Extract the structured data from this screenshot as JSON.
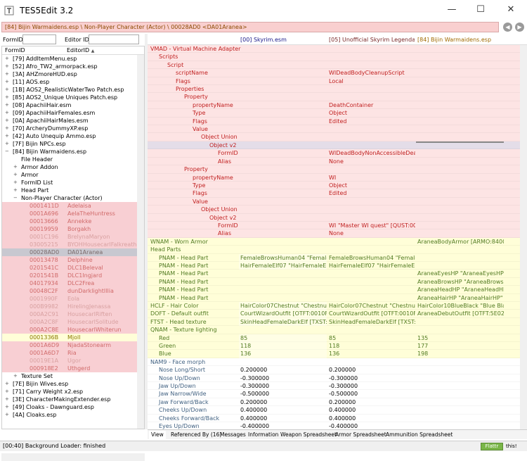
{
  "window": {
    "title": "TES5Edit 3.2",
    "min": "—",
    "max": "☐",
    "close": "✕"
  },
  "path": "[84] Bijin Warmaidens.esp \\ Non-Player Character (Actor) \\ 00028AD0 <DA01Aranea>",
  "nav": {
    "back": "◀",
    "fwd": "▶"
  },
  "filter": {
    "formid_label": "FormID",
    "editorid_label": "Editor ID",
    "formid_value": "",
    "editorid_value": ""
  },
  "tree": {
    "col1": "FormID",
    "col2": "EditorID",
    "sort": "▲",
    "rows": [
      {
        "ind": 0,
        "tg": "+",
        "a": "[79] AddItemMenu.esp",
        "b": "",
        "bg": "#fff",
        "fc": "#000"
      },
      {
        "ind": 0,
        "tg": "+",
        "a": "[52] Afro_TW2_armorpack.esp",
        "b": "",
        "bg": "#fff",
        "fc": "#000"
      },
      {
        "ind": 0,
        "tg": "+",
        "a": "[3A] AHZmoreHUD.esp",
        "b": "",
        "bg": "#fff",
        "fc": "#000"
      },
      {
        "ind": 0,
        "tg": "+",
        "a": "[11] AOS.esp",
        "b": "",
        "bg": "#fff",
        "fc": "#000"
      },
      {
        "ind": 0,
        "tg": "+",
        "a": "[1B] AOS2_RealisticWaterTwo Patch.esp",
        "b": "",
        "bg": "#fff",
        "fc": "#000"
      },
      {
        "ind": 0,
        "tg": "+",
        "a": "[85] AOS2_Unique Uniques Patch.esp",
        "b": "",
        "bg": "#fff",
        "fc": "#000"
      },
      {
        "ind": 0,
        "tg": "+",
        "a": "[08] ApachiiHair.esm",
        "b": "",
        "bg": "#fff",
        "fc": "#000"
      },
      {
        "ind": 0,
        "tg": "+",
        "a": "[09] ApachiiHairFemales.esm",
        "b": "",
        "bg": "#fff",
        "fc": "#000"
      },
      {
        "ind": 0,
        "tg": "+",
        "a": "[0A] ApachiiHairMales.esm",
        "b": "",
        "bg": "#fff",
        "fc": "#000"
      },
      {
        "ind": 0,
        "tg": "+",
        "a": "[70] ArcheryDummyXP.esp",
        "b": "",
        "bg": "#fff",
        "fc": "#000"
      },
      {
        "ind": 0,
        "tg": "+",
        "a": "[42] Auto Unequip Ammo.esp",
        "b": "",
        "bg": "#fff",
        "fc": "#000"
      },
      {
        "ind": 0,
        "tg": "+",
        "a": "[7F] Bijin NPCs.esp",
        "b": "",
        "bg": "#fff",
        "fc": "#000"
      },
      {
        "ind": 0,
        "tg": "−",
        "a": "[84] Bijin Warmaidens.esp",
        "b": "",
        "bg": "#fff",
        "fc": "#000"
      },
      {
        "ind": 1,
        "tg": "",
        "a": "File Header",
        "b": "",
        "bg": "#fff",
        "fc": "#000"
      },
      {
        "ind": 1,
        "tg": "+",
        "a": "Armor Addon",
        "b": "",
        "bg": "#fff",
        "fc": "#000"
      },
      {
        "ind": 1,
        "tg": "+",
        "a": "Armor",
        "b": "",
        "bg": "#fff",
        "fc": "#000"
      },
      {
        "ind": 1,
        "tg": "+",
        "a": "FormID List",
        "b": "",
        "bg": "#fff",
        "fc": "#000"
      },
      {
        "ind": 1,
        "tg": "+",
        "a": "Head Part",
        "b": "",
        "bg": "#fff",
        "fc": "#000"
      },
      {
        "ind": 1,
        "tg": "−",
        "a": "Non-Player Character (Actor)",
        "b": "",
        "bg": "#fff",
        "fc": "#000"
      },
      {
        "ind": 2,
        "tg": "",
        "a": "0001411D",
        "b": "Adelaisa",
        "bg": "#f8cfd3",
        "fc": "#d06a6a"
      },
      {
        "ind": 2,
        "tg": "",
        "a": "0001A696",
        "b": "AelaTheHuntress",
        "bg": "#f8cfd3",
        "fc": "#d06a6a"
      },
      {
        "ind": 2,
        "tg": "",
        "a": "00013666",
        "b": "Annekke",
        "bg": "#f8cfd3",
        "fc": "#d06a6a"
      },
      {
        "ind": 2,
        "tg": "",
        "a": "00019959",
        "b": "Borgakh",
        "bg": "#f8cfd3",
        "fc": "#d06a6a"
      },
      {
        "ind": 2,
        "tg": "",
        "a": "0001C196",
        "b": "BreIynaMaryon",
        "bg": "#f8cfd3",
        "fc": "#d8a0a0"
      },
      {
        "ind": 2,
        "tg": "",
        "a": "03005215",
        "b": "BYOHHousecarlFalkreath",
        "bg": "#f8cfd3",
        "fc": "#d8a0a0"
      },
      {
        "ind": 2,
        "tg": "",
        "a": "00028AD0",
        "b": "DA01Aranea",
        "bg": "#c8c8d0",
        "fc": "#7a6a6a"
      },
      {
        "ind": 2,
        "tg": "",
        "a": "00013478",
        "b": "Delphine",
        "bg": "#f8cfd3",
        "fc": "#d06a6a"
      },
      {
        "ind": 2,
        "tg": "",
        "a": "0201541C",
        "b": "DLC1Beleval",
        "bg": "#f8cfd3",
        "fc": "#d06a6a"
      },
      {
        "ind": 2,
        "tg": "",
        "a": "0201541B",
        "b": "DLC1Ingjard",
        "bg": "#f8cfd3",
        "fc": "#d06a6a"
      },
      {
        "ind": 2,
        "tg": "",
        "a": "04017934",
        "b": "DLC2Frea",
        "bg": "#f8cfd3",
        "fc": "#d06a6a"
      },
      {
        "ind": 2,
        "tg": "",
        "a": "00048C2F",
        "b": "dunDarklightIllia",
        "bg": "#f8cfd3",
        "fc": "#d06a6a"
      },
      {
        "ind": 2,
        "tg": "",
        "a": "0001990F",
        "b": "Eola",
        "bg": "#f8cfd3",
        "fc": "#d8a0a0"
      },
      {
        "ind": 2,
        "tg": "",
        "a": "000B9982",
        "b": "HirelingJenassa",
        "bg": "#f8cfd3",
        "fc": "#d8a0a0"
      },
      {
        "ind": 2,
        "tg": "",
        "a": "000A2C91",
        "b": "HousecarlRiften",
        "bg": "#f8cfd3",
        "fc": "#d8a0a0"
      },
      {
        "ind": 2,
        "tg": "",
        "a": "000A2C8F",
        "b": "HousecarlSolitude",
        "bg": "#f8cfd3",
        "fc": "#d8a0a0"
      },
      {
        "ind": 2,
        "tg": "",
        "a": "000A2C8E",
        "b": "HousecarlWhiterun",
        "bg": "#f8cfd3",
        "fc": "#d06a6a"
      },
      {
        "ind": 2,
        "tg": "",
        "a": "0001336B",
        "b": "Mjoll",
        "bg": "#fffed8",
        "fc": "#8a7a00"
      },
      {
        "ind": 2,
        "tg": "",
        "a": "0001A6D9",
        "b": "NjadaStonearm",
        "bg": "#f8cfd3",
        "fc": "#d06a6a"
      },
      {
        "ind": 2,
        "tg": "",
        "a": "0001A6D7",
        "b": "Ria",
        "bg": "#f8cfd3",
        "fc": "#d06a6a"
      },
      {
        "ind": 2,
        "tg": "",
        "a": "00019E1A",
        "b": "Ugor",
        "bg": "#f8cfd3",
        "fc": "#d8a0a0"
      },
      {
        "ind": 2,
        "tg": "",
        "a": "000918E2",
        "b": "Uthgerd",
        "bg": "#f8cfd3",
        "fc": "#d06a6a"
      },
      {
        "ind": 1,
        "tg": "+",
        "a": "Texture Set",
        "b": "",
        "bg": "#fff",
        "fc": "#000"
      },
      {
        "ind": 0,
        "tg": "+",
        "a": "[7E] Bijin Wives.esp",
        "b": "",
        "bg": "#fff",
        "fc": "#000"
      },
      {
        "ind": 0,
        "tg": "+",
        "a": "[71] Carry Weight x2.esp",
        "b": "",
        "bg": "#fff",
        "fc": "#000"
      },
      {
        "ind": 0,
        "tg": "+",
        "a": "[3E] CharacterMakingExtender.esp",
        "b": "",
        "bg": "#fff",
        "fc": "#000"
      },
      {
        "ind": 0,
        "tg": "+",
        "a": "[49] Cloaks - Dawnguard.esp",
        "b": "",
        "bg": "#fff",
        "fc": "#000"
      },
      {
        "ind": 0,
        "tg": "+",
        "a": "[4A] Cloaks.esp",
        "b": "",
        "bg": "#fff",
        "fc": "#000"
      }
    ]
  },
  "columns": {
    "c1": "[00] Skyrim.esm",
    "c2": "[05] Unofficial Skyrim Legendary ...",
    "c3": "[84] Bijin Warmaidens.esp"
  },
  "grid": [
    {
      "ind": 0,
      "n": "VMAD - Virtual Machine Adapter",
      "c1": "",
      "c2": "",
      "c3": "",
      "bg": "#fde4e4",
      "nc": "#c02020",
      "vc": "#c02020",
      "sel": false
    },
    {
      "ind": 1,
      "n": "Scripts",
      "c1": "",
      "c2": "",
      "c3": "",
      "bg": "#fde4e4",
      "nc": "#c02020",
      "vc": "#c02020",
      "sel": false
    },
    {
      "ind": 2,
      "n": "Script",
      "c1": "",
      "c2": "",
      "c3": "",
      "bg": "#fde4e4",
      "nc": "#c02020",
      "vc": "#c02020",
      "sel": false
    },
    {
      "ind": 3,
      "n": "scriptName",
      "c1": "",
      "c2": "WIDeadBodyCleanupScript",
      "c3": "",
      "bg": "#fde4e4",
      "nc": "#c02020",
      "vc": "#c02020",
      "sel": false
    },
    {
      "ind": 3,
      "n": "Flags",
      "c1": "",
      "c2": "Local",
      "c3": "",
      "bg": "#fde4e4",
      "nc": "#c02020",
      "vc": "#c02020",
      "sel": false
    },
    {
      "ind": 3,
      "n": "Properties",
      "c1": "",
      "c2": "",
      "c3": "",
      "bg": "#fde4e4",
      "nc": "#c02020",
      "vc": "#c02020",
      "sel": false
    },
    {
      "ind": 4,
      "n": "Property",
      "c1": "",
      "c2": "",
      "c3": "",
      "bg": "#fde4e4",
      "nc": "#c02020",
      "vc": "#c02020",
      "sel": false
    },
    {
      "ind": 5,
      "n": "propertyName",
      "c1": "",
      "c2": "DeathContainer",
      "c3": "",
      "bg": "#fde4e4",
      "nc": "#c02020",
      "vc": "#c02020",
      "sel": false
    },
    {
      "ind": 5,
      "n": "Type",
      "c1": "",
      "c2": "Object",
      "c3": "",
      "bg": "#fde4e4",
      "nc": "#c02020",
      "vc": "#c02020",
      "sel": false
    },
    {
      "ind": 5,
      "n": "Flags",
      "c1": "",
      "c2": "Edited",
      "c3": "",
      "bg": "#fde4e4",
      "nc": "#c02020",
      "vc": "#c02020",
      "sel": false
    },
    {
      "ind": 5,
      "n": "Value",
      "c1": "",
      "c2": "",
      "c3": "",
      "bg": "#fde4e4",
      "nc": "#c02020",
      "vc": "#c02020",
      "sel": false
    },
    {
      "ind": 6,
      "n": "Object Union",
      "c1": "",
      "c2": "",
      "c3": "",
      "bg": "#fde4e4",
      "nc": "#c02020",
      "vc": "#c02020",
      "sel": false
    },
    {
      "ind": 7,
      "n": "Object v2",
      "c1": "",
      "c2": "",
      "c3": "",
      "bg": "#e4dde8",
      "nc": "#c02020",
      "vc": "#c02020",
      "sel": true
    },
    {
      "ind": 8,
      "n": "FormID",
      "c1": "",
      "c2": "WIDeadBodyNonAccessibleDeath...",
      "c3": "",
      "bg": "#fde4e4",
      "nc": "#c02020",
      "vc": "#c02020",
      "sel": false
    },
    {
      "ind": 8,
      "n": "Alias",
      "c1": "",
      "c2": "None",
      "c3": "",
      "bg": "#fde4e4",
      "nc": "#c02020",
      "vc": "#c02020",
      "sel": false
    },
    {
      "ind": 4,
      "n": "Property",
      "c1": "",
      "c2": "",
      "c3": "",
      "bg": "#fde4e4",
      "nc": "#c02020",
      "vc": "#c02020",
      "sel": false
    },
    {
      "ind": 5,
      "n": "propertyName",
      "c1": "",
      "c2": "WI",
      "c3": "",
      "bg": "#fde4e4",
      "nc": "#c02020",
      "vc": "#c02020",
      "sel": false
    },
    {
      "ind": 5,
      "n": "Type",
      "c1": "",
      "c2": "Object",
      "c3": "",
      "bg": "#fde4e4",
      "nc": "#c02020",
      "vc": "#c02020",
      "sel": false
    },
    {
      "ind": 5,
      "n": "Flags",
      "c1": "",
      "c2": "Edited",
      "c3": "",
      "bg": "#fde4e4",
      "nc": "#c02020",
      "vc": "#c02020",
      "sel": false
    },
    {
      "ind": 5,
      "n": "Value",
      "c1": "",
      "c2": "",
      "c3": "",
      "bg": "#fde4e4",
      "nc": "#c02020",
      "vc": "#c02020",
      "sel": false
    },
    {
      "ind": 6,
      "n": "Object Union",
      "c1": "",
      "c2": "",
      "c3": "",
      "bg": "#fde4e4",
      "nc": "#c02020",
      "vc": "#c02020",
      "sel": false
    },
    {
      "ind": 7,
      "n": "Object v2",
      "c1": "",
      "c2": "",
      "c3": "",
      "bg": "#fde4e4",
      "nc": "#c02020",
      "vc": "#c02020",
      "sel": false
    },
    {
      "ind": 8,
      "n": "FormID",
      "c1": "",
      "c2": "WI \"Master WI quest\" [QUST:0003...",
      "c3": "",
      "bg": "#fde4e4",
      "nc": "#c02020",
      "vc": "#c02020",
      "sel": false
    },
    {
      "ind": 8,
      "n": "Alias",
      "c1": "",
      "c2": "None",
      "c3": "",
      "bg": "#fde4e4",
      "nc": "#c02020",
      "vc": "#c02020",
      "sel": false
    },
    {
      "ind": 0,
      "n": "WNAM - Worn Armor",
      "c1": "",
      "c2": "",
      "c3": "AraneaBodyArmor [ARMO:8400C...",
      "bg": "#fffed8",
      "nc": "#507a20",
      "vc": "#507a20",
      "sel": false
    },
    {
      "ind": 0,
      "n": "Head Parts",
      "c1": "",
      "c2": "",
      "c3": "",
      "bg": "#fffed8",
      "nc": "#507a20",
      "vc": "#507a20",
      "sel": false
    },
    {
      "ind": 1,
      "n": "PNAM - Head Part",
      "c1": "FemaleBrowsHuman04 \"FemaleB...",
      "c2": "FemaleBrowsHuman04 \"FemaleB...",
      "c3": "",
      "bg": "#fffed8",
      "nc": "#507a20",
      "vc": "#507a20",
      "sel": false
    },
    {
      "ind": 1,
      "n": "PNAM - Head Part",
      "c1": "HairFemaleElf07 \"HairFemaleElf07...",
      "c2": "HairFemaleElf07 \"HairFemaleElf07...",
      "c3": "",
      "bg": "#fffed8",
      "nc": "#507a20",
      "vc": "#507a20",
      "sel": false
    },
    {
      "ind": 1,
      "n": "PNAM - Head Part",
      "c1": "",
      "c2": "",
      "c3": "AraneaEyesHP \"AraneaEyesHP\" [...",
      "bg": "#fffed8",
      "nc": "#507a20",
      "vc": "#507a20",
      "sel": false
    },
    {
      "ind": 1,
      "n": "PNAM - Head Part",
      "c1": "",
      "c2": "",
      "c3": "AraneaBrowsHP \"AraneaBrowsHP...",
      "bg": "#fffed8",
      "nc": "#507a20",
      "vc": "#507a20",
      "sel": false
    },
    {
      "ind": 1,
      "n": "PNAM - Head Part",
      "c1": "",
      "c2": "",
      "c3": "AraneaHeadHP \"AraneaHeadHP\" ...",
      "bg": "#fffed8",
      "nc": "#507a20",
      "vc": "#507a20",
      "sel": false
    },
    {
      "ind": 1,
      "n": "PNAM - Head Part",
      "c1": "",
      "c2": "",
      "c3": "AraneaHairHP \"AraneaHairHP\" [...",
      "bg": "#fffed8",
      "nc": "#507a20",
      "vc": "#507a20",
      "sel": false
    },
    {
      "ind": 0,
      "n": "HCLF - Hair Color",
      "c1": "HairColor07Chestnut \"Chestnut\" ...",
      "c2": "HairColor07Chestnut \"Chestnut\" ...",
      "c3": "HairColor10BlueBlack \"Blue Black...",
      "bg": "#fffed8",
      "nc": "#507a20",
      "vc": "#507a20",
      "sel": false
    },
    {
      "ind": 0,
      "n": "DOFT - Default outfit",
      "c1": "CourtWizardOutfit [OTFT:0010FE6...",
      "c2": "CourtWizardOutfit [OTFT:0010FE6...",
      "c3": "AraneaDebutOutfit [OTFT:5E02E2...",
      "bg": "#fffed8",
      "nc": "#507a20",
      "vc": "#507a20",
      "sel": false
    },
    {
      "ind": 0,
      "n": "FTST - Head texture",
      "c1": "SkinHeadFemaleDarkElf [TXST:00...",
      "c2": "SkinHeadFemaleDarkElf [TXST:00...",
      "c3": "",
      "bg": "#fffed8",
      "nc": "#507a20",
      "vc": "#507a20",
      "sel": false
    },
    {
      "ind": 0,
      "n": "QNAM - Texture lighting",
      "c1": "",
      "c2": "",
      "c3": "",
      "bg": "#fffed8",
      "nc": "#507a20",
      "vc": "#507a20",
      "sel": false
    },
    {
      "ind": 1,
      "n": "Red",
      "c1": "85",
      "c2": "85",
      "c3": "135",
      "bg": "#fffed8",
      "nc": "#507a20",
      "vc": "#507a20",
      "sel": false
    },
    {
      "ind": 1,
      "n": "Green",
      "c1": "118",
      "c2": "118",
      "c3": "177",
      "bg": "#fffed8",
      "nc": "#507a20",
      "vc": "#507a20",
      "sel": false
    },
    {
      "ind": 1,
      "n": "Blue",
      "c1": "136",
      "c2": "136",
      "c3": "198",
      "bg": "#fffed8",
      "nc": "#507a20",
      "vc": "#507a20",
      "sel": false
    },
    {
      "ind": 0,
      "n": "NAM9 - Face morph",
      "c1": "",
      "c2": "",
      "c3": "",
      "bg": "#fff",
      "nc": "#406080",
      "vc": "#000",
      "sel": false
    },
    {
      "ind": 1,
      "n": "Nose Long/Short",
      "c1": "0.200000",
      "c2": "0.200000",
      "c3": "",
      "bg": "#fff",
      "nc": "#406080",
      "vc": "#000",
      "sel": false
    },
    {
      "ind": 1,
      "n": "Nose Up/Down",
      "c1": "-0.300000",
      "c2": "-0.300000",
      "c3": "",
      "bg": "#fff",
      "nc": "#406080",
      "vc": "#000",
      "sel": false
    },
    {
      "ind": 1,
      "n": "Jaw Up/Down",
      "c1": "-0.300000",
      "c2": "-0.300000",
      "c3": "",
      "bg": "#fff",
      "nc": "#406080",
      "vc": "#000",
      "sel": false
    },
    {
      "ind": 1,
      "n": "Jaw Narrow/Wide",
      "c1": "-0.500000",
      "c2": "-0.500000",
      "c3": "",
      "bg": "#fff",
      "nc": "#406080",
      "vc": "#000",
      "sel": false
    },
    {
      "ind": 1,
      "n": "Jaw Forward/Back",
      "c1": "0.200000",
      "c2": "0.200000",
      "c3": "",
      "bg": "#fff",
      "nc": "#406080",
      "vc": "#000",
      "sel": false
    },
    {
      "ind": 1,
      "n": "Cheeks Up/Down",
      "c1": "0.400000",
      "c2": "0.400000",
      "c3": "",
      "bg": "#fff",
      "nc": "#406080",
      "vc": "#000",
      "sel": false
    },
    {
      "ind": 1,
      "n": "Cheeks Forward/Back",
      "c1": "0.400000",
      "c2": "0.400000",
      "c3": "",
      "bg": "#fff",
      "nc": "#406080",
      "vc": "#000",
      "sel": false
    },
    {
      "ind": 1,
      "n": "Eyes Up/Down",
      "c1": "-0.400000",
      "c2": "-0.400000",
      "c3": "",
      "bg": "#fff",
      "nc": "#406080",
      "vc": "#000",
      "sel": false
    }
  ],
  "tabs": [
    "View",
    "Referenced By (16)",
    "Messages",
    "Information",
    "Weapon Spreadsheet",
    "Armor Spreadsheet",
    "Ammunition Spreadsheet"
  ],
  "status": {
    "text": "[00:40] Background Loader: finished",
    "flattr": "Flattr",
    "this": "this!"
  }
}
